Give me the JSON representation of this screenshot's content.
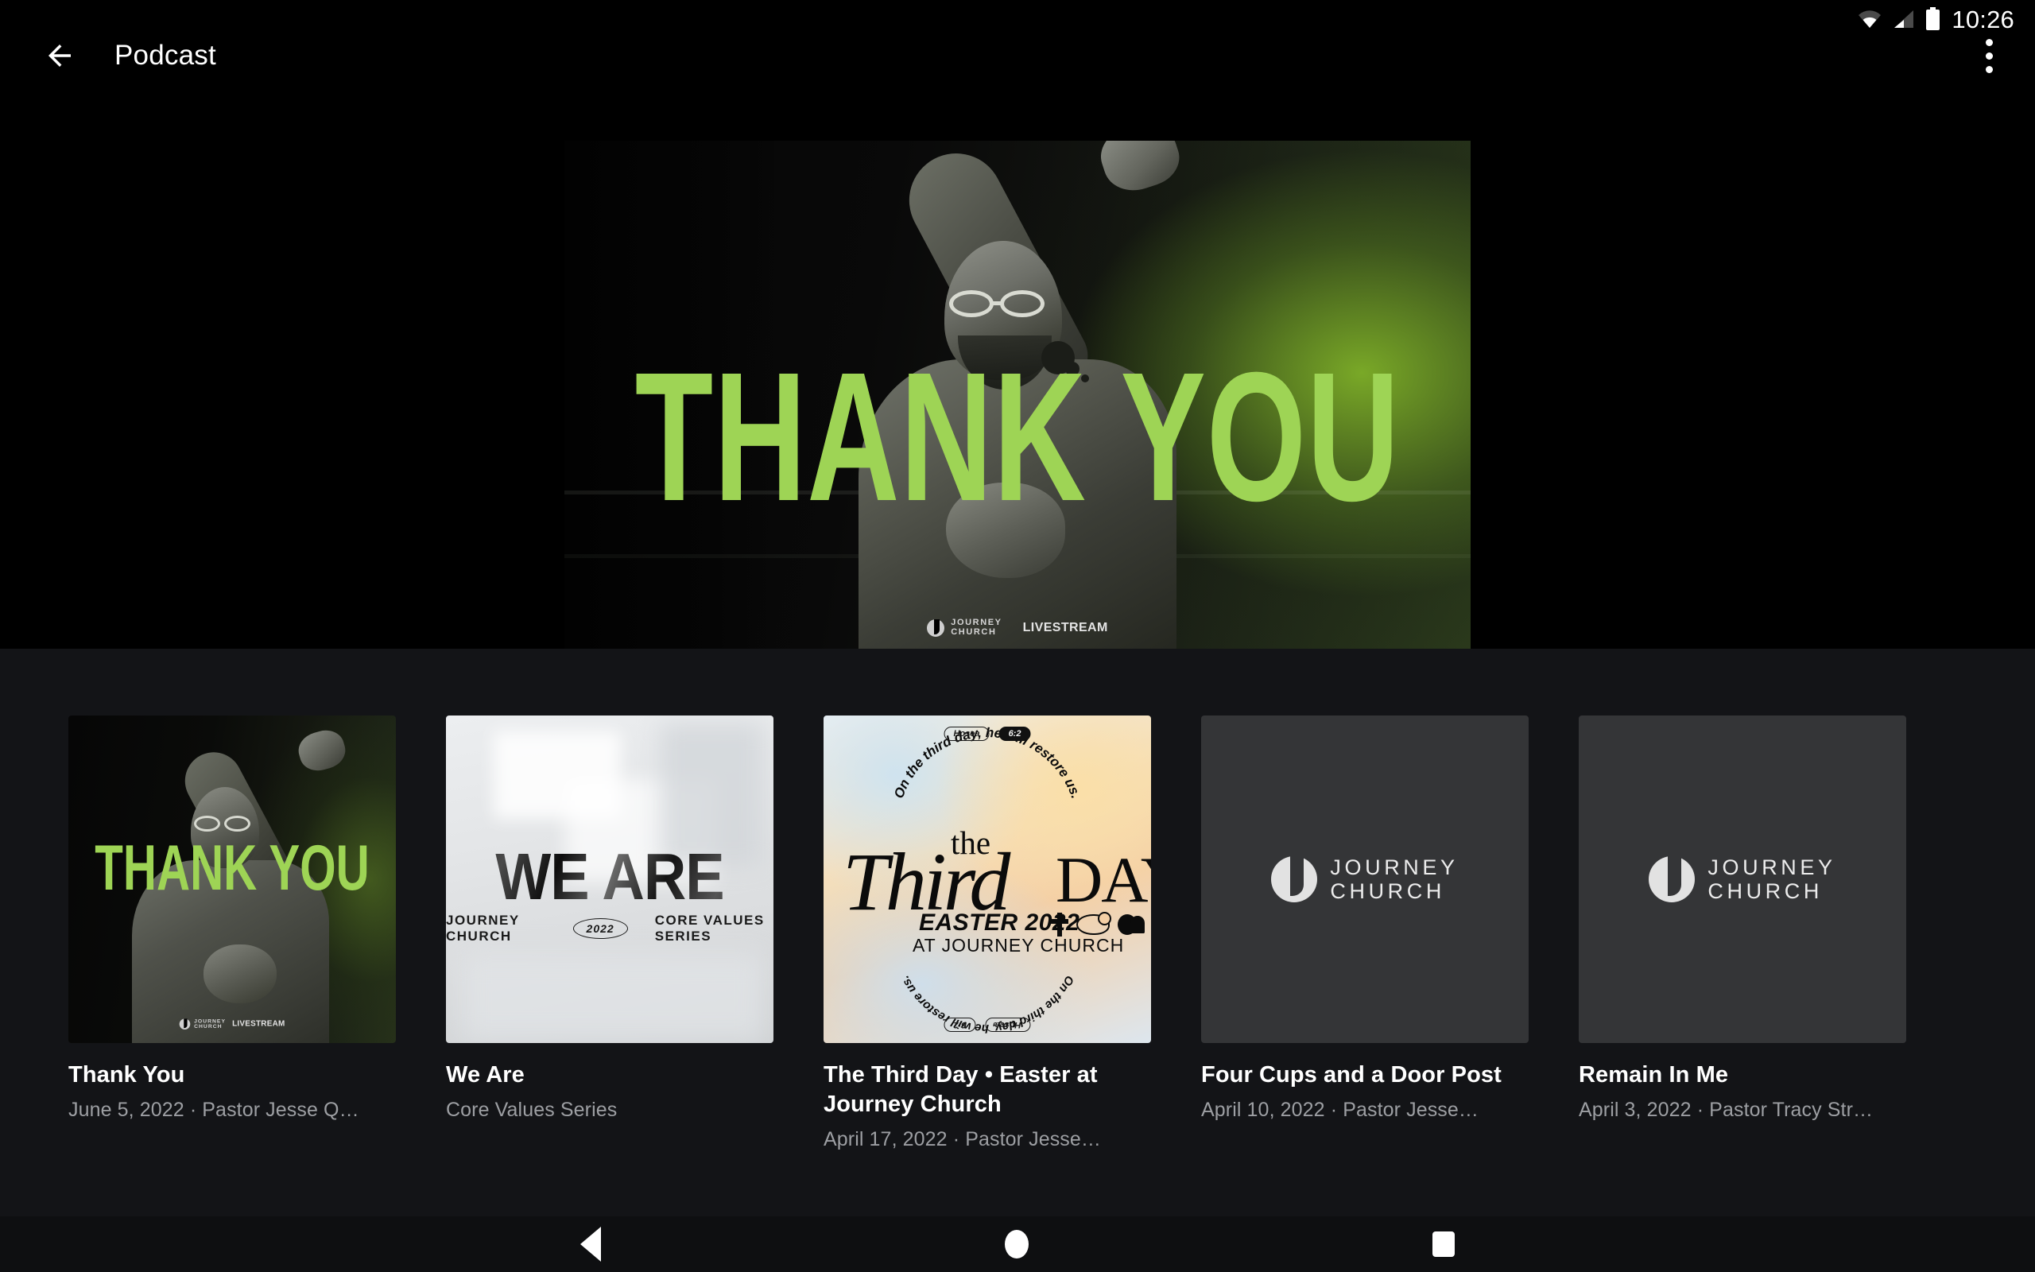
{
  "status_bar": {
    "time": "10:26",
    "icons": [
      "wifi-icon",
      "cellular-signal-icon",
      "battery-icon"
    ]
  },
  "app_bar": {
    "back_icon": "back-arrow-icon",
    "title": "Podcast",
    "overflow_icon": "more-vert-icon"
  },
  "hero": {
    "headline": "THANK YOU",
    "logo_line1": "JOURNEY",
    "logo_line2": "CHURCH",
    "logo_tag": "LIVESTREAM",
    "accent_green": "#9ed455",
    "background": "#000000"
  },
  "list": {
    "background": "#131417",
    "items": [
      {
        "title": "Thank You",
        "subtitle": "June 5, 2022 · Pastor Jesse Q…",
        "art": {
          "kind": "thank-you",
          "headline": "THANK YOU",
          "logo_line1": "JOURNEY",
          "logo_line2": "CHURCH",
          "logo_tag": "LIVESTREAM"
        }
      },
      {
        "title": "We Are",
        "subtitle": "Core Values Series",
        "art": {
          "kind": "we-are",
          "headline": "WE ARE",
          "left_label": "JOURNEY CHURCH",
          "year": "2022",
          "right_label": "CORE VALUES SERIES"
        }
      },
      {
        "title": "The Third Day • Easter at Journey Church",
        "subtitle": "April 17, 2022 · Pastor Jesse…",
        "art": {
          "kind": "third-day",
          "script_the": "the",
          "script_third": "Third",
          "script_day": "DAY",
          "easter_line": "EASTER 2022",
          "at_line": "AT JOURNEY CHURCH",
          "arc_text": "On the third day, he will restore us.",
          "badge_book": "Hosea",
          "badge_verse": "6:2",
          "icons": [
            "cross-icon",
            "lamb-icon",
            "tomb-icon"
          ]
        }
      },
      {
        "title": "Four Cups and a Door Post",
        "subtitle": "April 10, 2022 · Pastor Jesse…",
        "art": {
          "kind": "journey-logo",
          "logo_line1": "JOURNEY",
          "logo_line2": "CHURCH",
          "background": "#343537"
        }
      },
      {
        "title": "Remain In Me",
        "subtitle": "April 3, 2022 · Pastor Tracy Str…",
        "art": {
          "kind": "journey-logo",
          "logo_line1": "JOURNEY",
          "logo_line2": "CHURCH",
          "background": "#343537"
        }
      }
    ]
  },
  "nav_bar": {
    "back_icon": "nav-back-triangle-icon",
    "home_icon": "nav-home-circle-icon",
    "recents_icon": "nav-recents-square-icon"
  }
}
